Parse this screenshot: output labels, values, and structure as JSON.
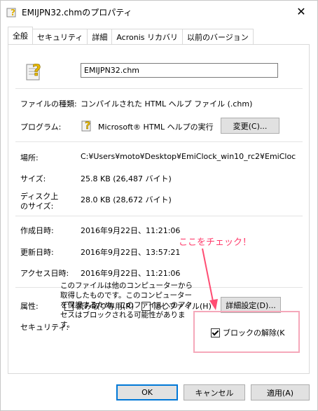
{
  "window": {
    "title": "EMIJPN32.chmのプロパティ",
    "close": "✕"
  },
  "tabs": [
    "全般",
    "セキュリティ",
    "詳細",
    "Acronis リカバリ",
    "以前のバージョン"
  ],
  "filename": "EMIJPN32.chm",
  "rows": {
    "type_label": "ファイルの種類:",
    "type_value": "コンパイルされた HTML ヘルプ ファイル (.chm)",
    "program_label": "プログラム:",
    "program_value": "Microsoft® HTML ヘルプの実行",
    "change_button": "変更(C)...",
    "location_label": "場所:",
    "location_value": "C:¥Users¥moto¥Desktop¥EmiClock_win10_rc2¥EmiCloc",
    "size_label": "サイズ:",
    "size_value": "25.8 KB (26,487 バイト)",
    "disk_label_1": "ディスク上",
    "disk_label_2": "のサイズ:",
    "disk_value": "28.0 KB (28,672 バイト)",
    "created_label": "作成日時:",
    "created_value": "2016年9月22日、11:21:06",
    "modified_label": "更新日時:",
    "modified_value": "2016年9月22日、13:57:21",
    "accessed_label": "アクセス日時:",
    "accessed_value": "2016年9月22日、11:21:06"
  },
  "attributes": {
    "label": "属性:",
    "readonly": "読み取り専用(R)",
    "hidden": "隠しファイル(H)",
    "advanced_button": "詳細設定(D)..."
  },
  "security": {
    "label": "セキュリティ:",
    "text": "このファイルは他のコンピューターから取得したものです。このコンピューターを保護するため、このファイルへのアクセスはブロックされる可能性があります。",
    "unblock": "ブロックの解除(K"
  },
  "annotation": "ここをチェック！",
  "buttons": {
    "ok": "OK",
    "cancel": "キャンセル",
    "apply": "適用(A)"
  }
}
